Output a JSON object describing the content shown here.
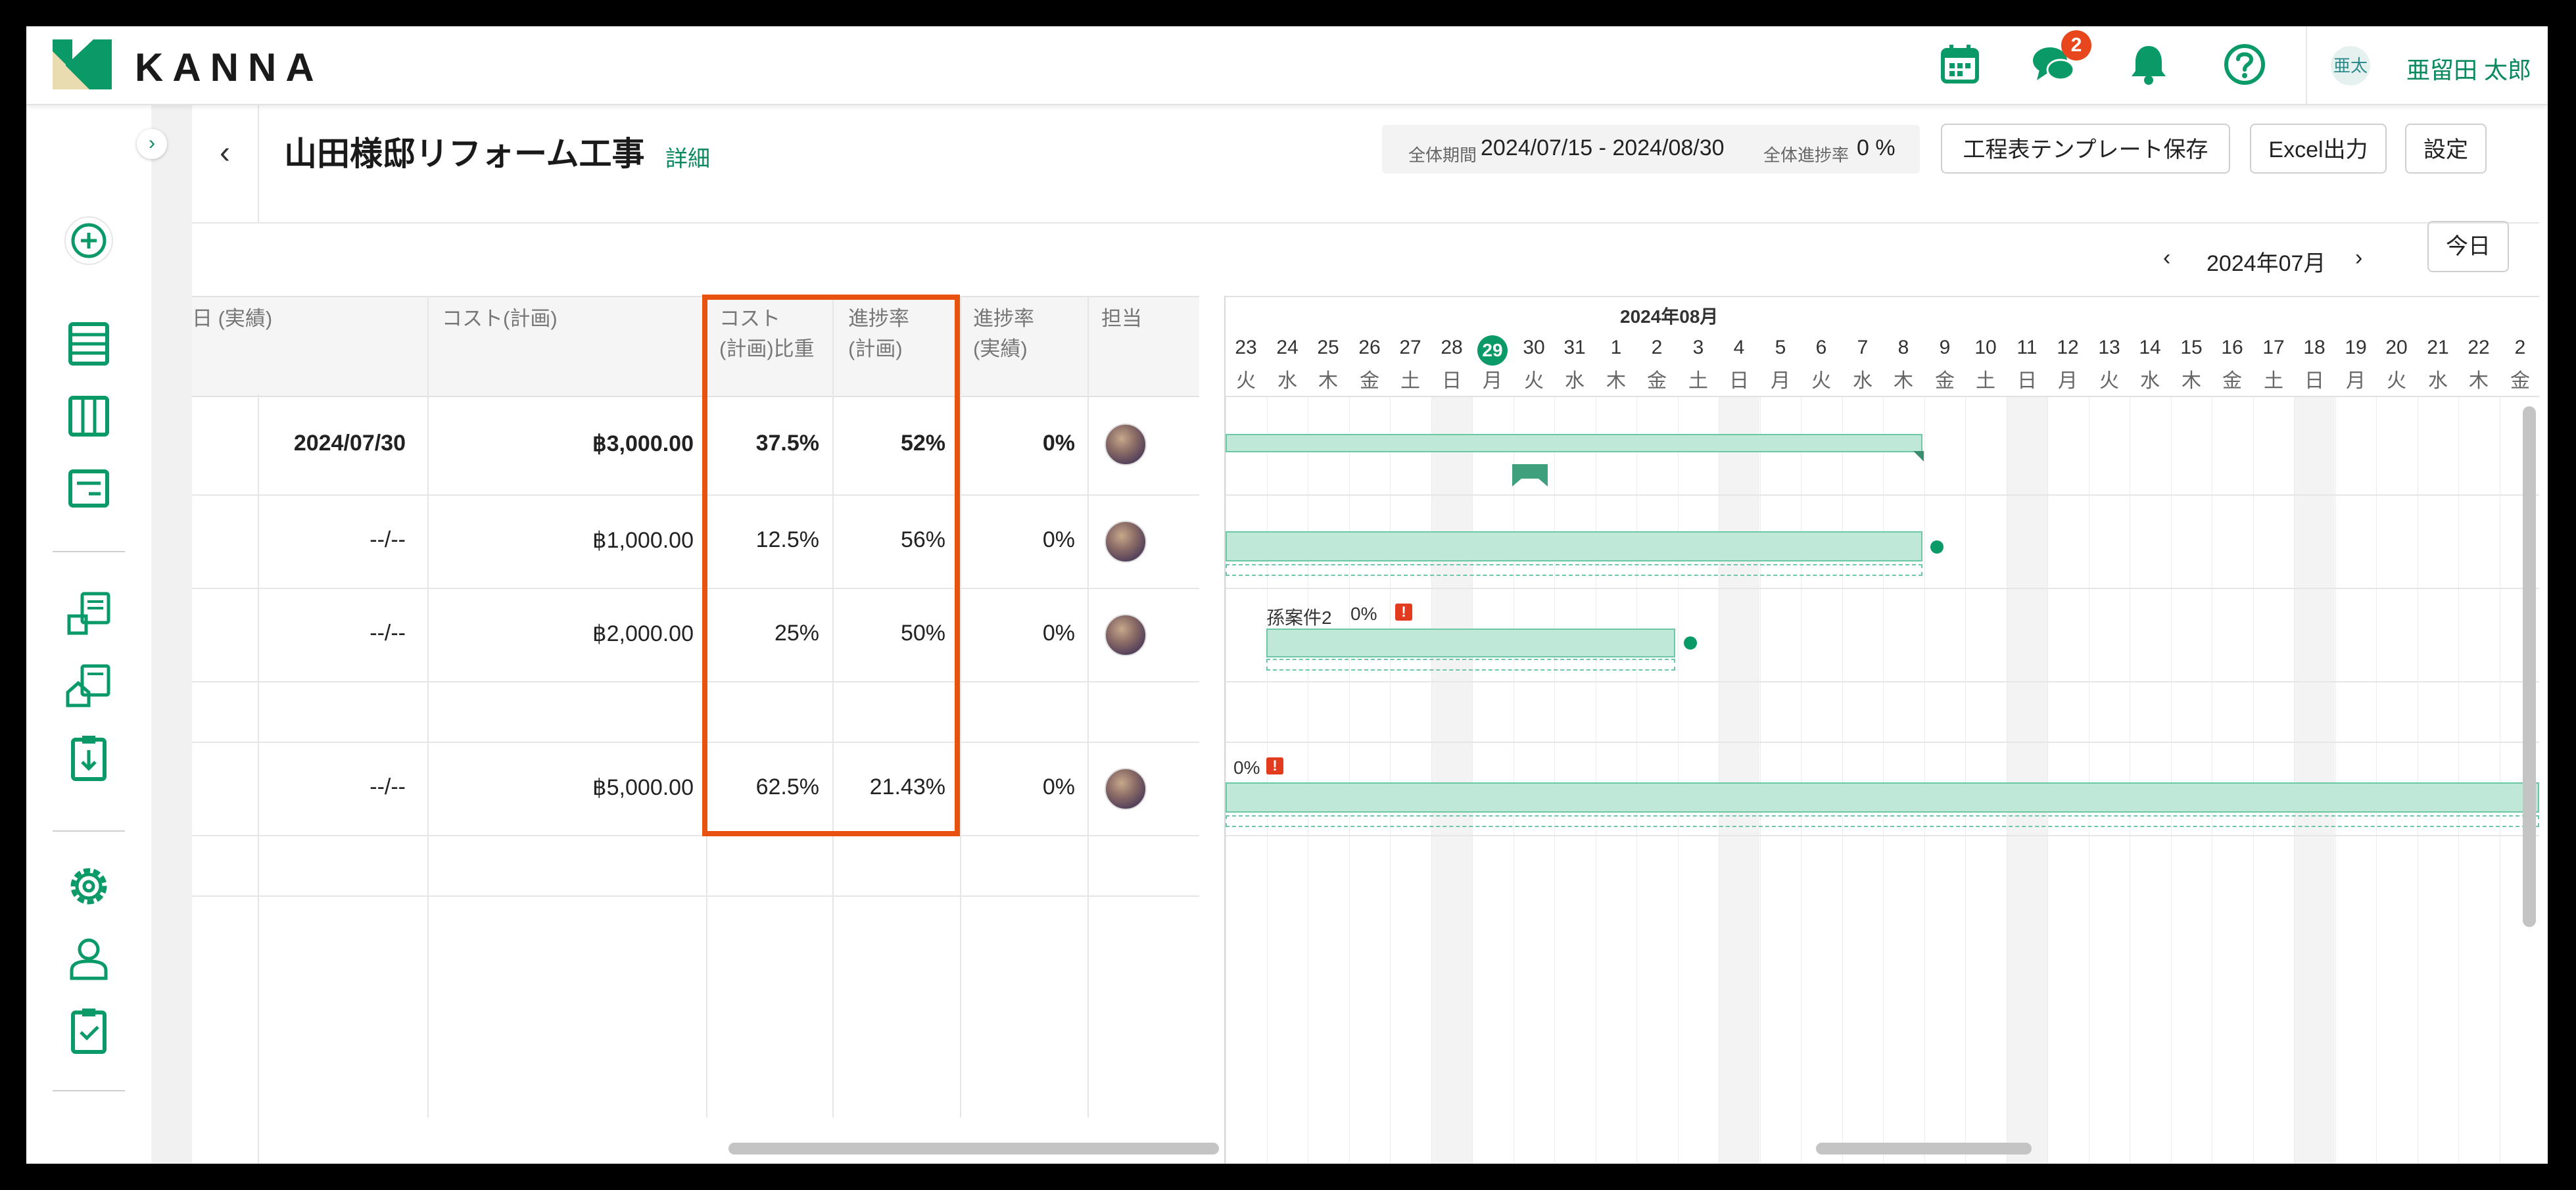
{
  "app": {
    "logo_text": "KANNA",
    "colors": {
      "brand": "#0a9a68",
      "accent": "#e8520e",
      "badge": "#e8471e",
      "bar_fill": "#bfe8d9"
    }
  },
  "header": {
    "icons": [
      "calendar-icon",
      "chat-icon",
      "bell-icon",
      "help-icon"
    ],
    "chat_badge": "2",
    "user_initials": "亜太",
    "user_name": "亜留田 太郎"
  },
  "sidebar": {
    "icons": [
      "add-icon",
      "list-icon",
      "board-icon",
      "document-icon",
      "building-report-icon",
      "house-report-icon",
      "clipboard-download-icon",
      "settings-icon",
      "user-icon",
      "clipboard-check-icon"
    ]
  },
  "project": {
    "title": "山田様邸リフォーム工事",
    "detail_link": "詳細",
    "period_label": "全体期間",
    "period_value": "2024/07/15 - 2024/08/30",
    "progress_label": "全体進捗率",
    "progress_value": "0 %"
  },
  "toolbar": {
    "template_save": "工程表テンプレート保存",
    "excel_export": "Excel出力",
    "settings": "設定"
  },
  "month_nav": {
    "label": "2024年07月",
    "today": "今日"
  },
  "table": {
    "headers": {
      "date_actual": "日 (実績)",
      "cost_plan": "コスト(計画)",
      "cost_weight_1": "コスト",
      "cost_weight_2": "(計画)比重",
      "progress_plan_1": "進捗率",
      "progress_plan_2": "(計画)",
      "progress_actual_1": "進捗率",
      "progress_actual_2": "(実績)",
      "assignee": "担当"
    },
    "rows": [
      {
        "date": "2024/07/30",
        "cost": "฿3,000.00",
        "weight": "37.5%",
        "plan": "52%",
        "actual": "0%",
        "bold": true
      },
      {
        "date": "--/--",
        "cost": "฿1,000.00",
        "weight": "12.5%",
        "plan": "56%",
        "actual": "0%",
        "bold": false
      },
      {
        "date": "--/--",
        "cost": "฿2,000.00",
        "weight": "25%",
        "plan": "50%",
        "actual": "0%",
        "bold": false
      },
      {
        "date": "",
        "cost": "",
        "weight": "",
        "plan": "",
        "actual": "",
        "bold": false
      },
      {
        "date": "--/--",
        "cost": "฿5,000.00",
        "weight": "62.5%",
        "plan": "21.43%",
        "actual": "0%",
        "bold": false
      }
    ]
  },
  "gantt": {
    "month_label": "2024年08月",
    "days": [
      {
        "d": "23",
        "w": "火"
      },
      {
        "d": "24",
        "w": "水"
      },
      {
        "d": "25",
        "w": "木"
      },
      {
        "d": "26",
        "w": "金"
      },
      {
        "d": "27",
        "w": "土"
      },
      {
        "d": "28",
        "w": "日"
      },
      {
        "d": "29",
        "w": "月"
      },
      {
        "d": "30",
        "w": "火"
      },
      {
        "d": "31",
        "w": "水"
      },
      {
        "d": "1",
        "w": "木"
      },
      {
        "d": "2",
        "w": "金"
      },
      {
        "d": "3",
        "w": "土"
      },
      {
        "d": "4",
        "w": "日"
      },
      {
        "d": "5",
        "w": "月"
      },
      {
        "d": "6",
        "w": "火"
      },
      {
        "d": "7",
        "w": "水"
      },
      {
        "d": "8",
        "w": "木"
      },
      {
        "d": "9",
        "w": "金"
      },
      {
        "d": "10",
        "w": "土"
      },
      {
        "d": "11",
        "w": "日"
      },
      {
        "d": "12",
        "w": "月"
      },
      {
        "d": "13",
        "w": "火"
      },
      {
        "d": "14",
        "w": "水"
      },
      {
        "d": "15",
        "w": "木"
      },
      {
        "d": "16",
        "w": "金"
      },
      {
        "d": "17",
        "w": "土"
      },
      {
        "d": "18",
        "w": "日"
      },
      {
        "d": "19",
        "w": "月"
      },
      {
        "d": "20",
        "w": "火"
      },
      {
        "d": "21",
        "w": "水"
      },
      {
        "d": "22",
        "w": "木"
      },
      {
        "d": "2",
        "w": "金"
      }
    ],
    "today_day": "29",
    "task_label_row3": "孫案件2",
    "task_pct_row3": "0%",
    "task_pct_row5": "0%",
    "warn_mark": "!"
  }
}
